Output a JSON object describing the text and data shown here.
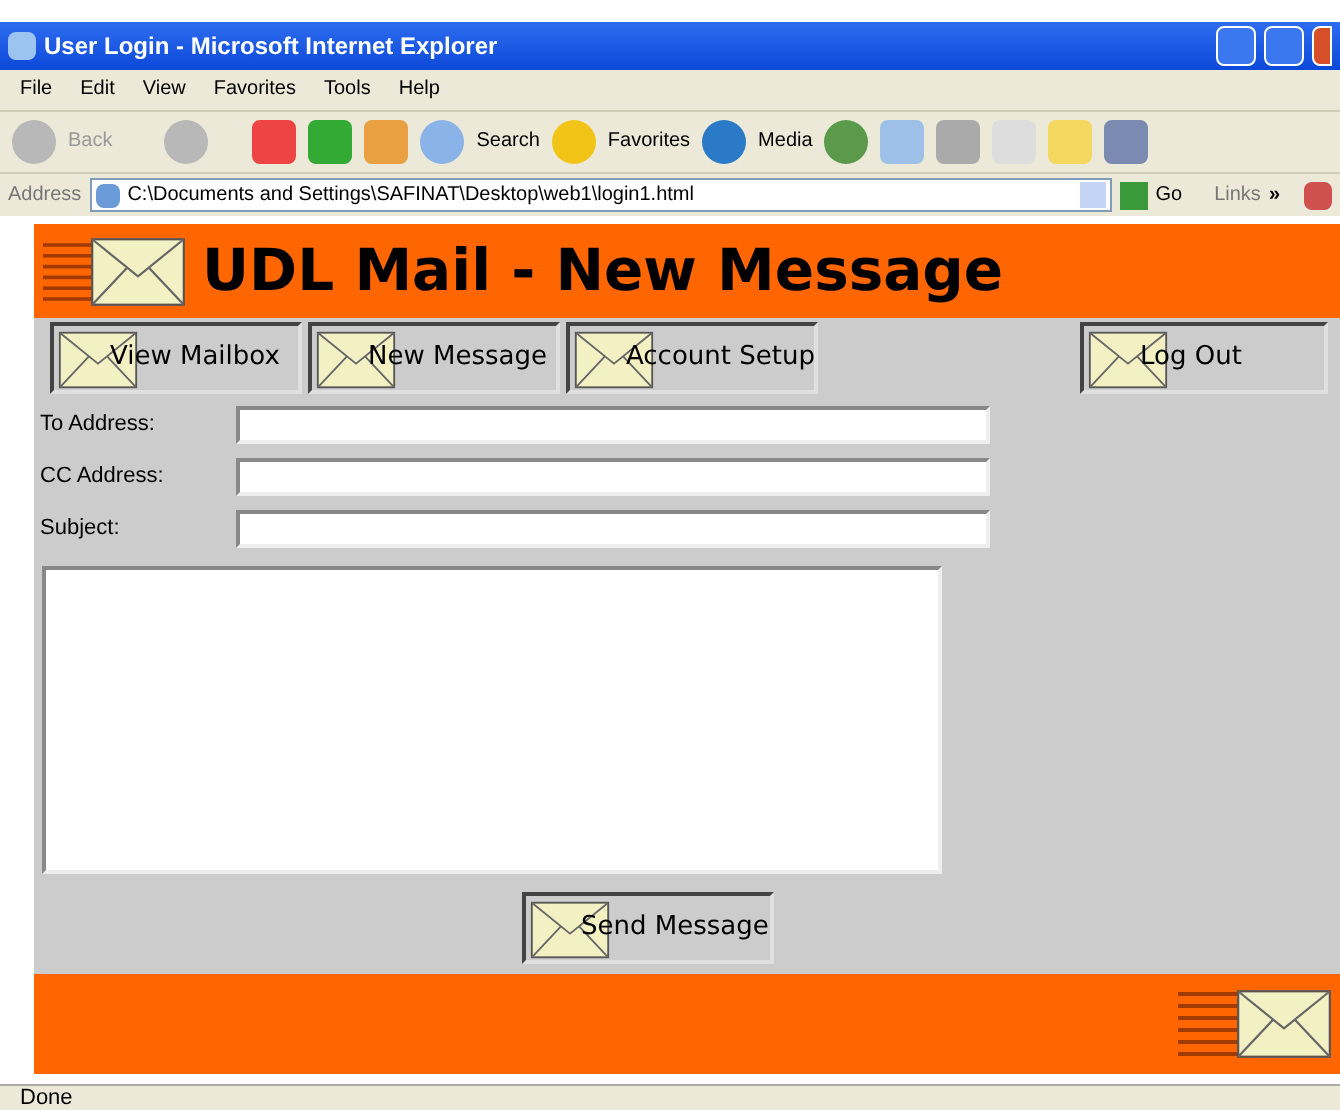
{
  "window": {
    "title": "User Login - Microsoft Internet Explorer"
  },
  "menu": [
    "File",
    "Edit",
    "View",
    "Favorites",
    "Tools",
    "Help"
  ],
  "toolbar": {
    "back": "Back",
    "search": "Search",
    "favorites": "Favorites",
    "media": "Media"
  },
  "address_bar": {
    "label": "Address",
    "value": "C:\\Documents and Settings\\SAFINAT\\Desktop\\web1\\login1.html",
    "go": "Go",
    "links": "Links",
    "more": "»"
  },
  "page": {
    "heading": "UDL Mail - New Message",
    "nav": [
      {
        "label": "View Mailbox"
      },
      {
        "label": "New Message"
      },
      {
        "label": "Account Setup"
      }
    ],
    "logout": "Log Out",
    "fields": [
      {
        "label": "To Address:"
      },
      {
        "label": "CC Address:"
      },
      {
        "label": "Subject:"
      }
    ],
    "send": "Send Message"
  },
  "status_bar": {
    "text": "Done"
  }
}
